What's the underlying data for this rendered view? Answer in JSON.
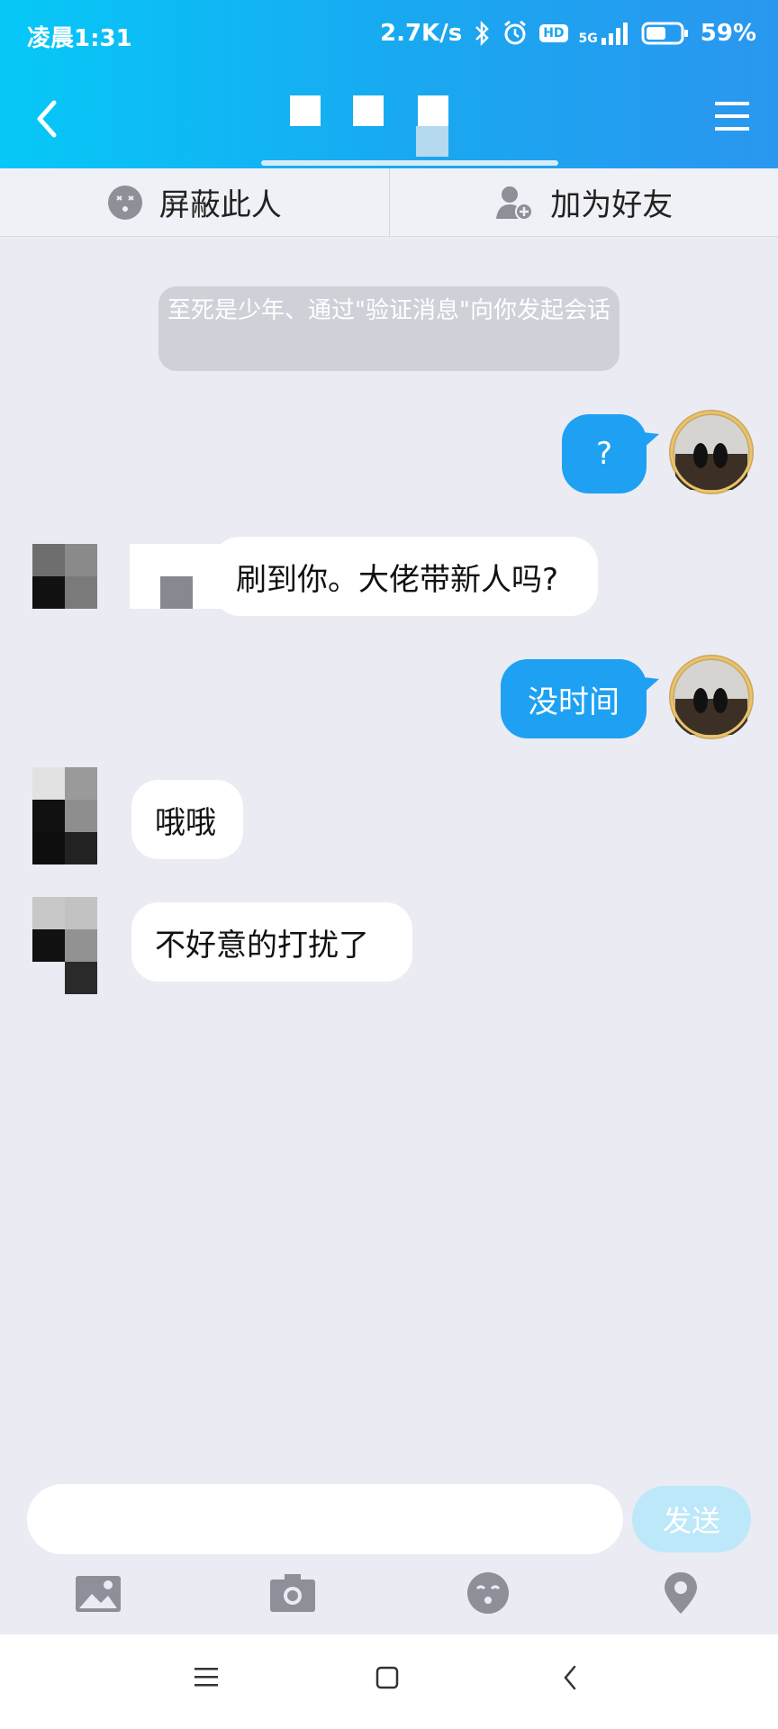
{
  "status_bar": {
    "time": "凌晨1:31",
    "speed": "2.7K/s",
    "network": "5G",
    "hd": "HD",
    "battery": "59%",
    "battery_level": 0.59
  },
  "header": {
    "colors": {
      "from": "#06c8f8",
      "to": "#2a97ef"
    }
  },
  "actions": {
    "block_label": "屏蔽此人",
    "add_friend_label": "加为好友"
  },
  "system_message": "至死是少年、通过\"验证消息\"向你发起会话",
  "messages": [
    {
      "side": "out",
      "text": "?"
    },
    {
      "side": "in",
      "text": "刷到你。大佬带新人吗?"
    },
    {
      "side": "out",
      "text": "没时间"
    },
    {
      "side": "in",
      "text": "哦哦"
    },
    {
      "side": "in",
      "text": "不好意的打扰了"
    }
  ],
  "composer": {
    "input_value": "",
    "send_label": "发送"
  },
  "toolbar": {
    "icons": [
      "image-icon",
      "camera-icon",
      "emoji-icon",
      "location-icon"
    ]
  },
  "system_nav": {
    "icons": [
      "menu-icon",
      "home-icon",
      "back-icon"
    ]
  }
}
